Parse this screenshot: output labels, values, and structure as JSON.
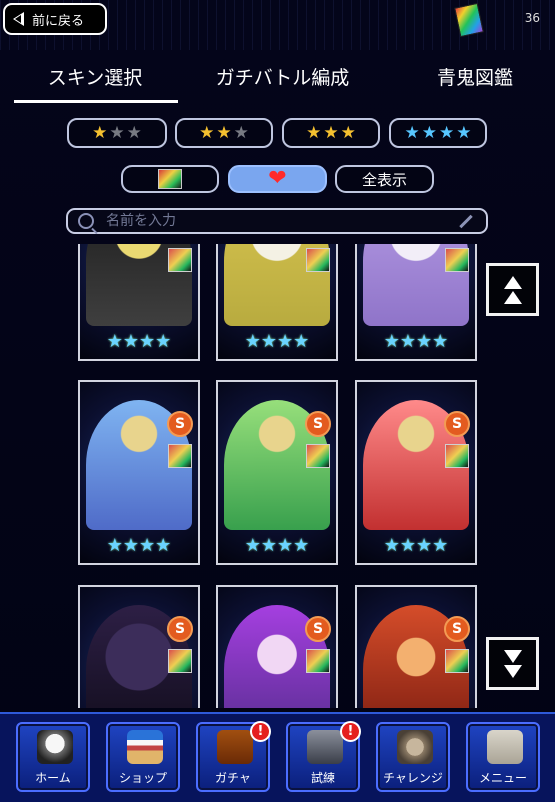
{
  "header": {
    "back_label": "前に戻る",
    "counter": "36"
  },
  "tabs": [
    {
      "label": "スキン選択",
      "active": true
    },
    {
      "label": "ガチバトル編成",
      "active": false
    },
    {
      "label": "青鬼図鑑",
      "active": false
    }
  ],
  "star_filters": [
    {
      "stars": "★★★",
      "gold": 1,
      "grey": 2
    },
    {
      "stars": "★★★",
      "gold": 2,
      "grey": 1
    },
    {
      "stars": "★★★",
      "gold": 3,
      "grey": 0
    },
    {
      "stars": "★★★★",
      "rainbow": 4
    }
  ],
  "filters": {
    "favorites_icon": "heart-icon",
    "show_all_label": "全表示",
    "active": "favorites"
  },
  "search": {
    "placeholder": "名前を入力"
  },
  "cards": [
    {
      "name": "bear-skin",
      "stars": "★★★★",
      "badge": false,
      "art": "bear"
    },
    {
      "name": "wedding-yellow",
      "stars": "★★★★",
      "badge": false,
      "art": "yellow"
    },
    {
      "name": "wedding-purple",
      "stars": "★★★★",
      "badge": false,
      "art": "purple"
    },
    {
      "name": "wedding-blue",
      "stars": "★★★★",
      "badge": true,
      "art": "blue"
    },
    {
      "name": "wedding-green",
      "stars": "★★★★",
      "badge": true,
      "art": "green"
    },
    {
      "name": "wedding-red",
      "stars": "★★★★",
      "badge": true,
      "art": "red"
    },
    {
      "name": "shadow-boy",
      "stars": "★★★★",
      "badge": true,
      "art": "shadow"
    },
    {
      "name": "violet-dragon-girl",
      "stars": "★★★★",
      "badge": true,
      "art": "violet"
    },
    {
      "name": "fire-dragon-girl",
      "stars": "★★★★",
      "badge": true,
      "art": "fire"
    }
  ],
  "bottom_nav": [
    {
      "label": "ホーム",
      "icon": "home-icon",
      "alert": false
    },
    {
      "label": "ショップ",
      "icon": "shop-icon",
      "alert": false
    },
    {
      "label": "ガチャ",
      "icon": "gacha-icon",
      "alert": true
    },
    {
      "label": "試練",
      "icon": "trial-icon",
      "alert": true
    },
    {
      "label": "チャレンジ",
      "icon": "challenge-icon",
      "alert": false
    },
    {
      "label": "メニュー",
      "icon": "menu-icon",
      "alert": false
    }
  ],
  "colors": {
    "background": "#02030f",
    "tab_underline": "#ffffff",
    "filter_active": "#7aa6ef",
    "nav_bg": "#07145c",
    "badge": "#e35b1f",
    "alert": "#e51f1f"
  }
}
